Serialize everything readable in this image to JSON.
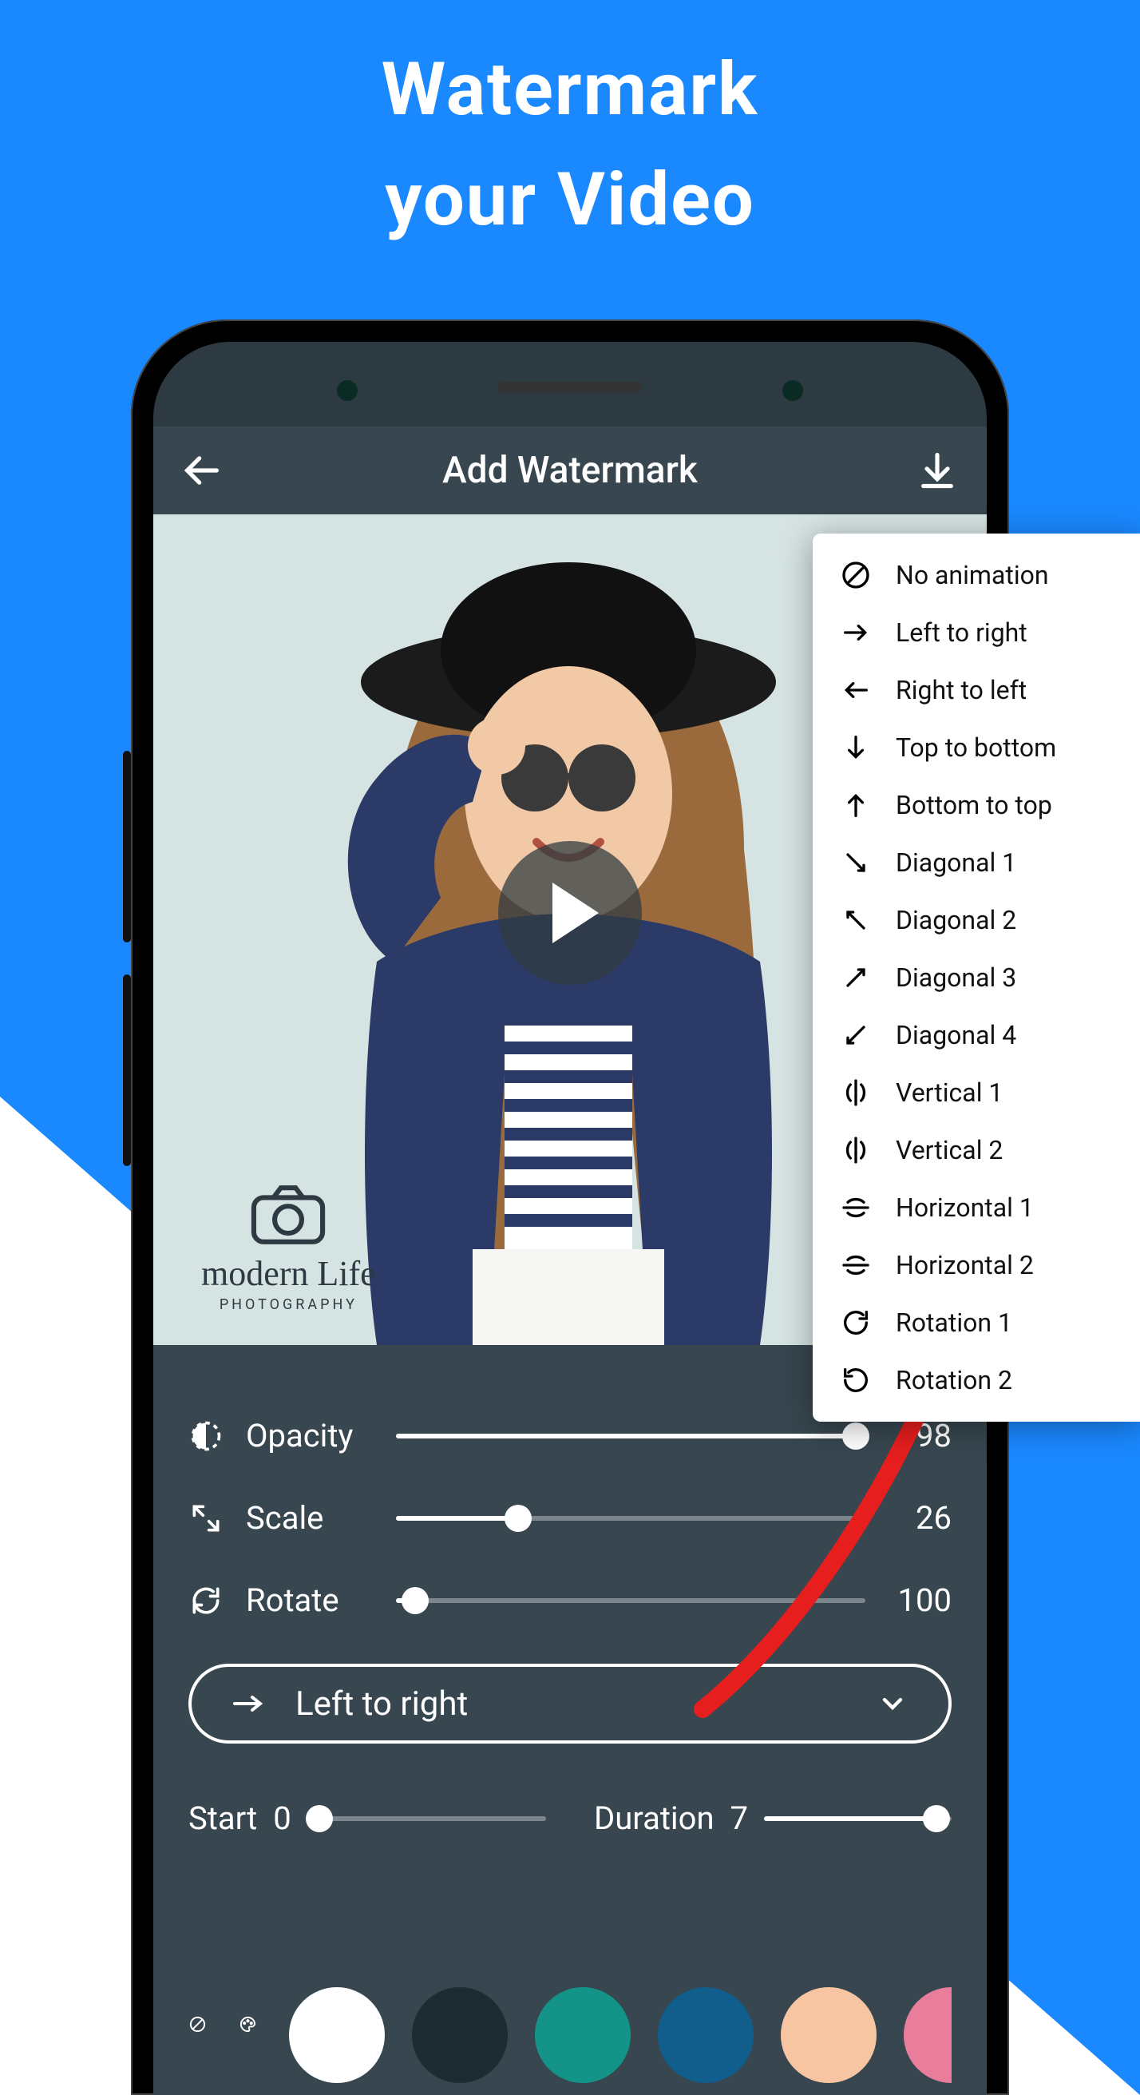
{
  "promo": {
    "line1": "Watermark",
    "line2": "your Video"
  },
  "toolbar": {
    "title": "Add Watermark"
  },
  "watermark_preview": {
    "brand": "modern Life",
    "sub": "PHOTOGRAPHY"
  },
  "sliders": {
    "opacity": {
      "label": "Opacity",
      "value": 98,
      "max": 100
    },
    "scale": {
      "label": "Scale",
      "value": 26,
      "max": 100
    },
    "rotate": {
      "label": "Rotate",
      "value": 100,
      "max": 100,
      "fill_pct": 4
    }
  },
  "animation": {
    "selected": "Left to right",
    "icon": "arrow-right"
  },
  "start": {
    "label": "Start",
    "value": 0,
    "fill_pct": 5
  },
  "duration": {
    "label": "Duration",
    "value": 7,
    "fill_pct": 92
  },
  "colors": [
    "#ffffff",
    "#1f2b33",
    "#149489",
    "#115e8c",
    "#f7c5a1",
    "#ea7d9c"
  ],
  "dropdown": [
    {
      "icon": "none",
      "label": "No animation"
    },
    {
      "icon": "arrow-right",
      "label": "Left to right"
    },
    {
      "icon": "arrow-left",
      "label": "Right to left"
    },
    {
      "icon": "arrow-down",
      "label": "Top to bottom"
    },
    {
      "icon": "arrow-up",
      "label": "Bottom to top"
    },
    {
      "icon": "diag-dr",
      "label": "Diagonal 1"
    },
    {
      "icon": "diag-ul",
      "label": "Diagonal 2"
    },
    {
      "icon": "diag-ur",
      "label": "Diagonal 3"
    },
    {
      "icon": "diag-dl",
      "label": "Diagonal 4"
    },
    {
      "icon": "flip-v1",
      "label": "Vertical 1"
    },
    {
      "icon": "flip-v2",
      "label": "Vertical 2"
    },
    {
      "icon": "flip-h1",
      "label": "Horizontal 1"
    },
    {
      "icon": "flip-h2",
      "label": "Horizontal 2"
    },
    {
      "icon": "rot-cw",
      "label": "Rotation 1"
    },
    {
      "icon": "rot-ccw",
      "label": "Rotation 2"
    }
  ]
}
